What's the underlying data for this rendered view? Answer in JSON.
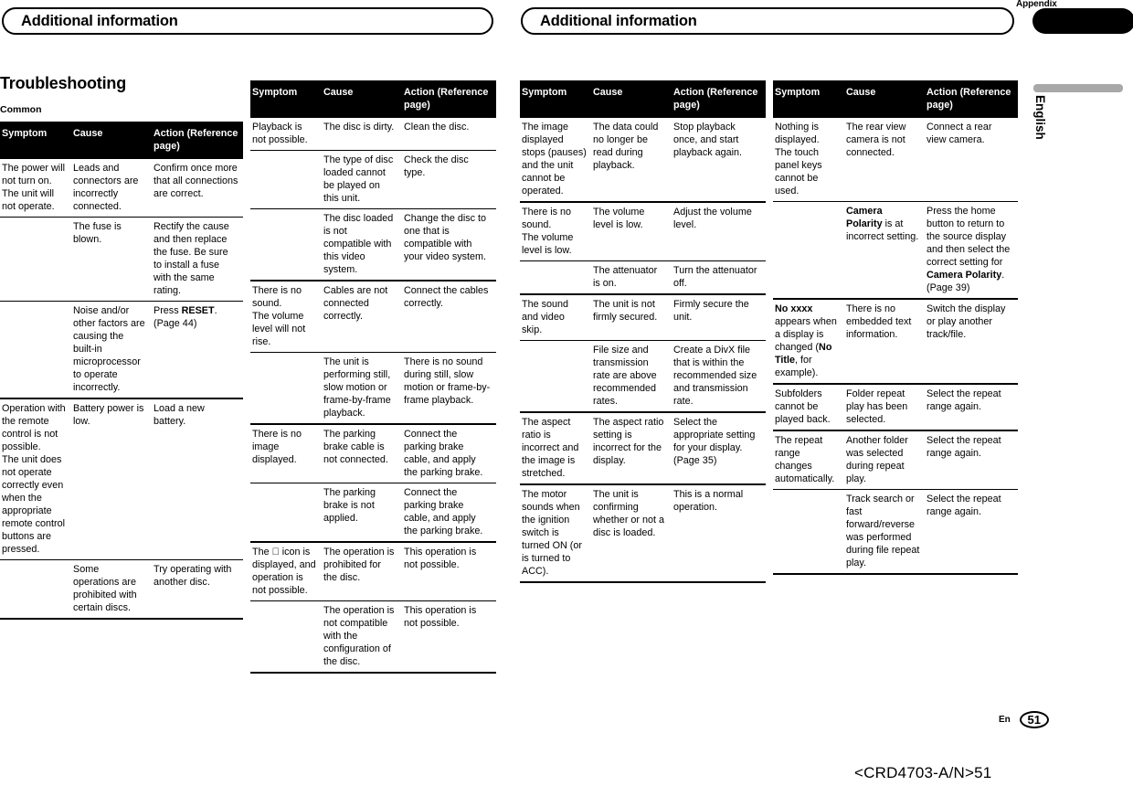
{
  "header": {
    "banner_left_title": "Additional information",
    "banner_right_title": "Additional information",
    "appendix_label": "Appendix"
  },
  "sidebar": {
    "language_tab": "English"
  },
  "content": {
    "section_title": "Troubleshooting",
    "subsection_title": "Common"
  },
  "footer": {
    "locale": "En",
    "page_number": "51",
    "doc_code": "<CRD4703-A/N>51"
  },
  "columns": {
    "symptom": "Symptom",
    "cause": "Cause",
    "action": "Action (Reference page)"
  },
  "tables": [
    {
      "id": "table-common",
      "headers": [
        "Symptom",
        "Cause",
        "Action (Reference page)"
      ],
      "rows": [
        {
          "symptom": "The power will not turn on.\nThe unit will not operate.",
          "cause": "Leads and connectors are incorrectly connected.",
          "action": "Confirm once more that all connections are correct."
        },
        {
          "symptom": "",
          "cause": "The fuse is blown.",
          "action": "Rectify the cause and then replace the fuse. Be sure to install a fuse with the same rating."
        },
        {
          "symptom": "",
          "cause": "Noise and/or other factors are causing the built-in microprocessor to operate incorrectly.",
          "action": "Press RESET. (Page 44)",
          "action_bold": "RESET"
        },
        {
          "symptom": "Operation with the remote control is not possible.\nThe unit does not operate correctly even when the appropriate remote control buttons are pressed.",
          "cause": "Battery power is low.",
          "action": "Load a new battery."
        },
        {
          "symptom": "",
          "cause": "Some operations are prohibited with certain discs.",
          "action": "Try operating with another disc."
        }
      ]
    },
    {
      "id": "table-disc-playback",
      "headers": [
        "Symptom",
        "Cause",
        "Action (Reference page)"
      ],
      "rows": [
        {
          "symptom": "Playback is not possible.",
          "cause": "The disc is dirty.",
          "action": "Clean the disc."
        },
        {
          "symptom": "",
          "cause": "The type of disc loaded cannot be played on this unit.",
          "action": "Check the disc type."
        },
        {
          "symptom": "",
          "cause": "The disc loaded is not compatible with this video system.",
          "action": "Change the disc to one that is compatible with your video system."
        },
        {
          "symptom": "There is no sound.\nThe volume level will not rise.",
          "cause": "Cables are not connected correctly.",
          "action": "Connect the cables correctly."
        },
        {
          "symptom": "",
          "cause": "The unit is performing still, slow motion or frame-by-frame playback.",
          "action": "There is no sound during still, slow motion or frame-by-frame playback."
        },
        {
          "symptom": "There is no image displayed.",
          "cause": "The parking brake cable is not connected.",
          "action": "Connect the parking brake cable, and apply the parking brake."
        },
        {
          "symptom": "",
          "cause": "The parking brake is not applied.",
          "action": "Connect the parking brake cable, and apply the parking brake."
        },
        {
          "symptom": "The ⃠ icon is displayed, and operation is not possible.",
          "cause": "The operation is prohibited for the disc.",
          "action": "This operation is not possible."
        },
        {
          "symptom": "",
          "cause": "The operation is not compatible with the configuration of the disc.",
          "action": "This operation is not possible."
        }
      ]
    },
    {
      "id": "table-image-sound",
      "headers": [
        "Symptom",
        "Cause",
        "Action (Reference page)"
      ],
      "rows": [
        {
          "symptom": "The image displayed stops (pauses) and the unit cannot be operated.",
          "cause": "The data could no longer be read during playback.",
          "action": "Stop playback once, and start playback again."
        },
        {
          "symptom": "There is no sound.\nThe volume level is low.",
          "cause": "The volume level is low.",
          "action": "Adjust the volume level."
        },
        {
          "symptom": "",
          "cause": "The attenuator is on.",
          "action": "Turn the attenuator off."
        },
        {
          "symptom": "The sound and video skip.",
          "cause": "The unit is not firmly secured.",
          "action": "Firmly secure the unit."
        },
        {
          "symptom": "",
          "cause": "File size and transmission rate are above recommended rates.",
          "action": "Create a DivX file that is within the recommended size and transmission rate."
        },
        {
          "symptom": "The aspect ratio is incorrect and the image is stretched.",
          "cause": "The aspect ratio setting is incorrect for the display.",
          "action": "Select the appropriate setting for your display. (Page 35)"
        },
        {
          "symptom": "The motor sounds when the ignition switch is turned ON (or is turned to ACC).",
          "cause": "The unit is confirming whether or not a disc is loaded.",
          "action": "This is a normal operation."
        }
      ]
    },
    {
      "id": "table-display-repeat",
      "headers": [
        "Symptom",
        "Cause",
        "Action (Reference page)"
      ],
      "rows": [
        {
          "symptom": "Nothing is displayed.\nThe touch panel keys cannot be used.",
          "cause": "The rear view camera is not connected.",
          "action": "Connect a rear view camera."
        },
        {
          "symptom": "",
          "cause": "Camera Polarity is at incorrect setting.",
          "cause_bold": "Camera Polarity",
          "action": "Press the home button to return to the source display and then select the correct setting for Camera Polarity. (Page 39)",
          "action_bold": "Camera Polarity"
        },
        {
          "symptom": "No xxxx appears when a display is changed (No Title, for example).",
          "symptom_bold": [
            "No xxxx",
            "No Title"
          ],
          "cause": "There is no embedded text information.",
          "action": "Switch the display or play another track/file."
        },
        {
          "symptom": "Subfolders cannot be played back.",
          "cause": "Folder repeat play has been selected.",
          "action": "Select the repeat range again."
        },
        {
          "symptom": "The repeat range changes automatically.",
          "cause": "Another folder was selected during repeat play.",
          "action": "Select the repeat range again."
        },
        {
          "symptom": "",
          "cause": "Track search or fast forward/reverse was performed during file repeat play.",
          "action": "Select the repeat range again."
        }
      ]
    }
  ]
}
